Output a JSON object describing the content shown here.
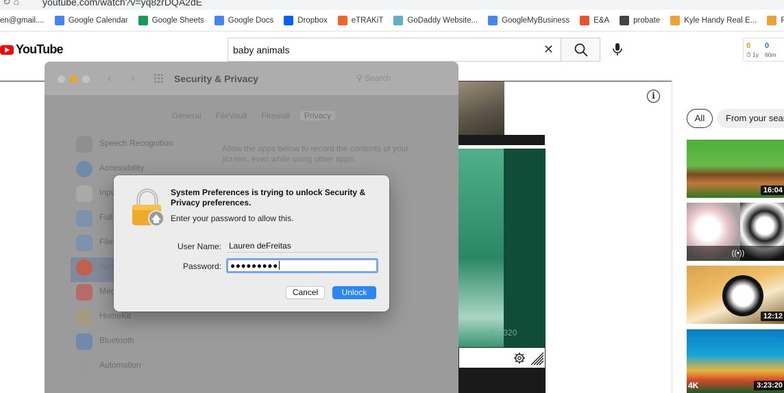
{
  "browser": {
    "url": "youtube.com/watch?v=yq8zrDQA2dE",
    "bookmarks": [
      {
        "label": "en@gmail....",
        "icon": "gmail-icon",
        "color": "#ffffff"
      },
      {
        "label": "Google Calendar",
        "icon": "calendar-icon",
        "color": "#4285f4"
      },
      {
        "label": "Google Sheets",
        "icon": "sheets-icon",
        "color": "#0f9d58"
      },
      {
        "label": "Google Docs",
        "icon": "docs-icon",
        "color": "#4285f4"
      },
      {
        "label": "Dropbox",
        "icon": "dropbox-icon",
        "color": "#0061ff"
      },
      {
        "label": "eTRAKiT",
        "icon": "etrakit-icon",
        "color": "#f26522"
      },
      {
        "label": "GoDaddy Website...",
        "icon": "godaddy-icon",
        "color": "#5ab2c9"
      },
      {
        "label": "GoogleMyBusiness",
        "icon": "business-icon",
        "color": "#4285f4"
      },
      {
        "label": "E&A",
        "icon": "ea-icon",
        "color": "#e8532b"
      },
      {
        "label": "probate",
        "icon": "globe-icon",
        "color": "#444444"
      },
      {
        "label": "Kyle Handy Real E...",
        "icon": "kyle-icon",
        "color": "#f0a030"
      },
      {
        "label": "Re",
        "icon": "kyle-icon",
        "color": "#f0a030"
      }
    ]
  },
  "youtube": {
    "logo_text": "YouTube",
    "search_value": "baby animals",
    "ext": {
      "n1": "0",
      "n2": "0",
      "l1": "1y",
      "l2": "60m"
    },
    "chips": [
      "All",
      "From your sear"
    ],
    "thumbs": [
      {
        "duration": "16:04"
      },
      {
        "live_glyph": "((•))"
      },
      {
        "duration": "12:12"
      },
      {
        "duration": "3:23:20",
        "tag": "4K"
      }
    ],
    "video_dims": "2 x 320"
  },
  "sysprefs": {
    "title": "Security & Privacy",
    "search_placeholder": "Search",
    "tabs": [
      "General",
      "FileVault",
      "Firewall",
      "Privacy"
    ],
    "active_tab": "Privacy",
    "list": [
      {
        "label": "Speech Recognition"
      },
      {
        "label": "Accessibility"
      },
      {
        "label": "Inpu"
      },
      {
        "label": "Full"
      },
      {
        "label": "Files"
      },
      {
        "label": "Scre"
      },
      {
        "label": "Med"
      },
      {
        "label": "HomeKit"
      },
      {
        "label": "Bluetooth"
      },
      {
        "label": "Automation"
      }
    ],
    "description": "Allow the apps below to record the contents of your screen, even while using other apps."
  },
  "dialog": {
    "title": "System Preferences is trying to unlock Security & Privacy preferences.",
    "subtitle": "Enter your password to allow this.",
    "user_label": "User Name:",
    "user_value": "Lauren deFreitas",
    "pass_label": "Password:",
    "pass_value": "●●●●●●●●●",
    "cancel": "Cancel",
    "unlock": "Unlock"
  }
}
